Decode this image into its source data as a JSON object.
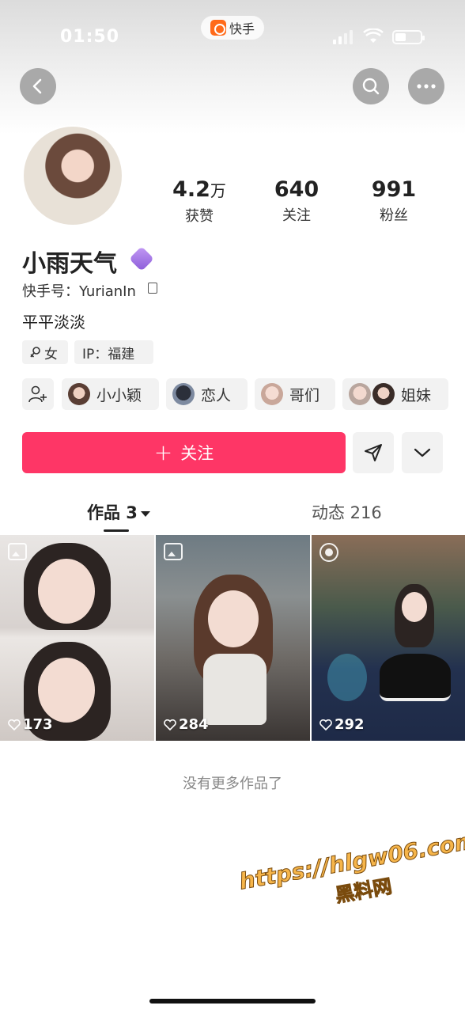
{
  "status_bar": {
    "time": "01:50",
    "app_name": "快手"
  },
  "profile": {
    "name": "小雨天气",
    "kuaishou_id": "快手号：YurianIn",
    "bio": "平平淡淡",
    "gender_tag": "女",
    "ip_tag": "IP：福建",
    "stats": [
      {
        "value": "4.2",
        "unit": "万",
        "label": "获赞"
      },
      {
        "value": "640",
        "unit": "",
        "label": "关注"
      },
      {
        "value": "991",
        "unit": "",
        "label": "粉丝"
      }
    ]
  },
  "relations": [
    "小小颖",
    "恋人",
    "哥们",
    "姐妹"
  ],
  "actions": {
    "follow_label": "关注"
  },
  "tabs": {
    "works_label": "作品 3",
    "dynamic_label": "动态 216"
  },
  "posts": [
    {
      "likes": "173",
      "type": "album-icon"
    },
    {
      "likes": "284",
      "type": "album-icon"
    },
    {
      "likes": "292",
      "type": "live-photo-icon"
    }
  ],
  "footer_text": "没有更多作品了",
  "watermark": {
    "url": "https://hlgw06.com",
    "text": "黑料网"
  },
  "colors": {
    "accent": "#fe3666"
  }
}
